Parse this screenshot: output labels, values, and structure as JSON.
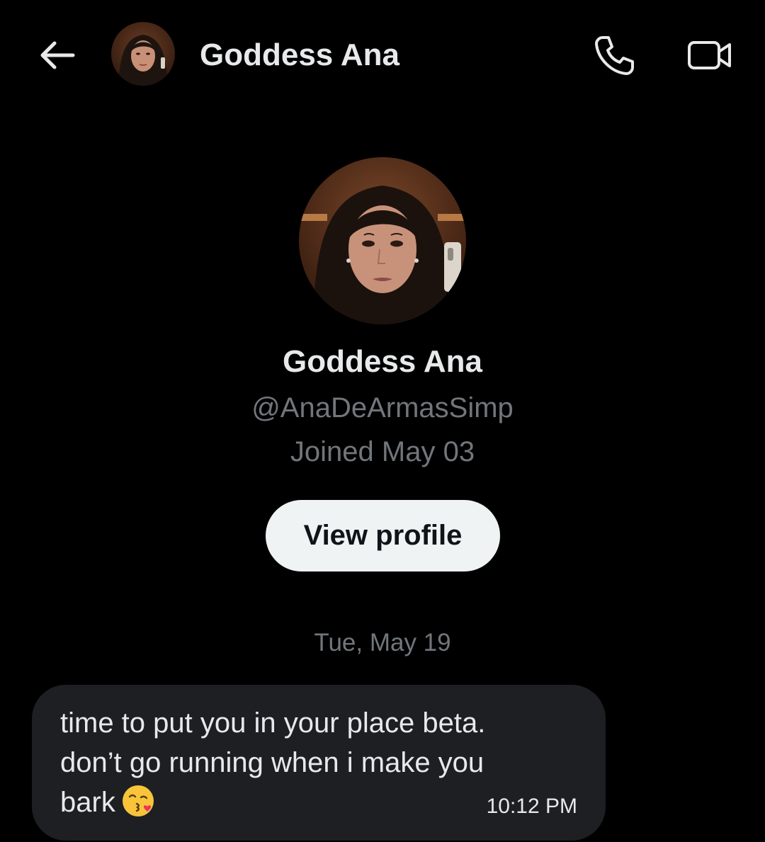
{
  "header": {
    "title": "Goddess Ana",
    "back_icon": "arrow-left-icon",
    "call_icon": "phone-icon",
    "video_icon": "video-camera-icon"
  },
  "profile": {
    "name": "Goddess Ana",
    "handle": "@AnaDeArmasSimp",
    "joined": "Joined May 03",
    "view_profile_label": "View profile"
  },
  "conversation": {
    "date_divider": "Tue, May 19",
    "messages": [
      {
        "text": "time to put you in your place beta.\ndon’t go running when i make you\nbark",
        "emoji": "kissing-face-with-heart-icon",
        "time": "10:12 PM"
      }
    ]
  },
  "colors": {
    "background": "#000000",
    "primary_text": "#e7e9ea",
    "secondary_text": "#71767b",
    "bubble": "#1d1f23",
    "button_bg": "#eff3f4",
    "button_text": "#0f1419"
  }
}
